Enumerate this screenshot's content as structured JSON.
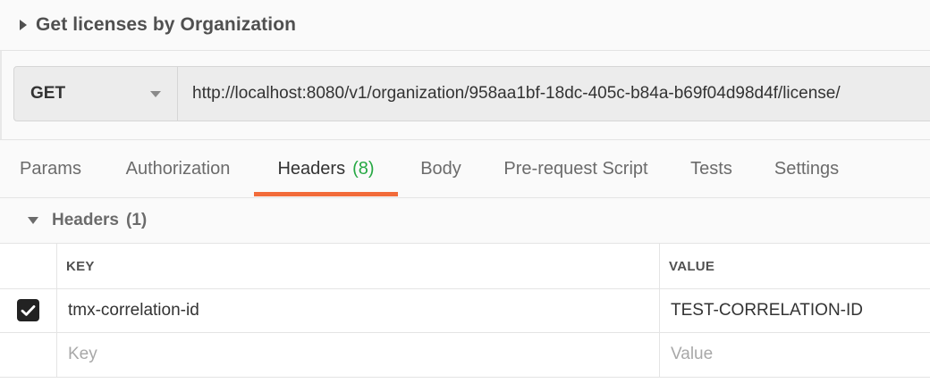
{
  "request": {
    "title": "Get licenses by Organization",
    "method": "GET",
    "url": "http://localhost:8080/v1/organization/958aa1bf-18dc-405c-b84a-b69f04d98d4f/license/"
  },
  "tabs": [
    {
      "label": "Params"
    },
    {
      "label": "Authorization"
    },
    {
      "label": "Headers",
      "count": "(8)",
      "active": true
    },
    {
      "label": "Body"
    },
    {
      "label": "Pre-request Script"
    },
    {
      "label": "Tests"
    },
    {
      "label": "Settings"
    }
  ],
  "headers_section": {
    "title": "Headers",
    "count": "(1)"
  },
  "table": {
    "columns": {
      "key": "KEY",
      "value": "VALUE"
    },
    "rows": [
      {
        "checked": true,
        "key": "tmx-correlation-id",
        "value": "TEST-CORRELATION-ID"
      }
    ],
    "placeholder": {
      "key": "Key",
      "value": "Value"
    }
  },
  "colors": {
    "active_tab_underline": "#f26b3a",
    "tab_count": "#26a843",
    "checkbox": "#222222"
  },
  "icons": {
    "title_caret": "caret-right-icon",
    "method_caret": "chevron-down-icon",
    "section_caret": "caret-down-icon",
    "checkbox": "checkmark-icon"
  }
}
